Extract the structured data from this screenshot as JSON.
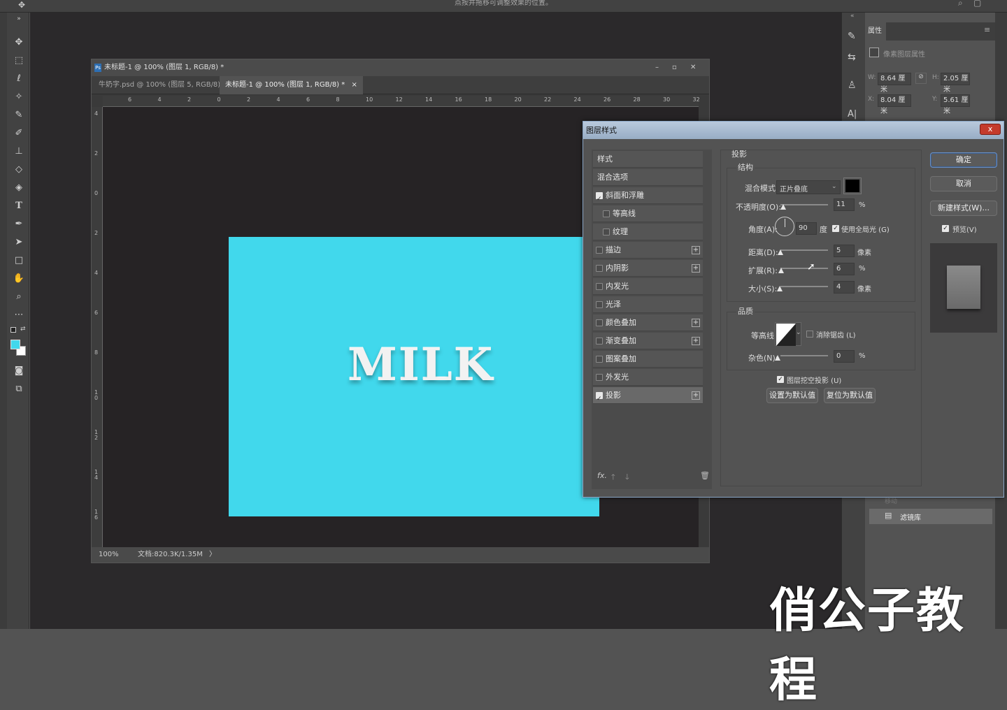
{
  "app": {
    "top_hint": "点按并拖移可调整效果的位置。"
  },
  "document": {
    "title": "未标题-1 @ 100% (图层 1, RGB/8) *",
    "tabs": [
      {
        "label": "牛奶字.psd @ 100% (图层 5, RGB/8) *"
      },
      {
        "label": "未标题-1 @ 100% (图层 1, RGB/8) *"
      }
    ],
    "canvas_text": "MILK",
    "canvas_color": "#41d8ec",
    "status_zoom": "100%",
    "status_doc": "文档:820.3K/1.35M",
    "h_ruler": [
      "6",
      "4",
      "2",
      "0",
      "2",
      "4",
      "6",
      "8",
      "10",
      "12",
      "14",
      "16",
      "18",
      "20",
      "22",
      "24",
      "26",
      "28",
      "30",
      "32"
    ],
    "v_ruler": [
      "4",
      "2",
      "0",
      "2",
      "4",
      "6",
      "8",
      "1 0",
      "1 2",
      "1 4",
      "1 6"
    ]
  },
  "properties_panel": {
    "tab": "属性",
    "subtitle": "像素图层属性",
    "w_label": "W:",
    "w_value": "8.64 厘米",
    "h_label": "H:",
    "h_value": "2.05 厘米",
    "x_label": "X:",
    "x_value": "8.04 厘米",
    "y_label": "Y:",
    "y_value": "5.61 厘米",
    "layer_hidden_label": "移动",
    "layer_filter": "滤镜库"
  },
  "dialog": {
    "title": "图层样式",
    "close": "x",
    "styles": [
      {
        "label": "样式",
        "checkbox": false,
        "checked": false,
        "plus": false,
        "indent": false
      },
      {
        "label": "混合选项",
        "checkbox": false,
        "checked": false,
        "plus": false,
        "indent": false
      },
      {
        "label": "斜面和浮雕",
        "checkbox": true,
        "checked": true,
        "plus": false,
        "indent": false
      },
      {
        "label": "等高线",
        "checkbox": true,
        "checked": false,
        "plus": false,
        "indent": true
      },
      {
        "label": "纹理",
        "checkbox": true,
        "checked": false,
        "plus": false,
        "indent": true
      },
      {
        "label": "描边",
        "checkbox": true,
        "checked": false,
        "plus": true,
        "indent": false
      },
      {
        "label": "内阴影",
        "checkbox": true,
        "checked": false,
        "plus": true,
        "indent": false
      },
      {
        "label": "内发光",
        "checkbox": true,
        "checked": false,
        "plus": false,
        "indent": false
      },
      {
        "label": "光泽",
        "checkbox": true,
        "checked": false,
        "plus": false,
        "indent": false
      },
      {
        "label": "颜色叠加",
        "checkbox": true,
        "checked": false,
        "plus": true,
        "indent": false
      },
      {
        "label": "渐变叠加",
        "checkbox": true,
        "checked": false,
        "plus": true,
        "indent": false
      },
      {
        "label": "图案叠加",
        "checkbox": true,
        "checked": false,
        "plus": false,
        "indent": false
      },
      {
        "label": "外发光",
        "checkbox": true,
        "checked": false,
        "plus": false,
        "indent": false
      },
      {
        "label": "投影",
        "checkbox": true,
        "checked": true,
        "plus": true,
        "indent": false
      }
    ],
    "section_title": "投影",
    "structure_title": "结构",
    "blend_mode_label": "混合模式:",
    "blend_mode_value": "正片叠底",
    "shadow_color": "#000000",
    "opacity_label": "不透明度(O):",
    "opacity_value": "11",
    "opacity_unit": "%",
    "angle_label": "角度(A):",
    "angle_value": "90",
    "angle_unit": "度",
    "global_light_label": "使用全局光 (G)",
    "distance_label": "距离(D):",
    "distance_value": "5",
    "distance_unit": "像素",
    "spread_label": "扩展(R):",
    "spread_value": "6",
    "spread_unit": "%",
    "size_label": "大小(S):",
    "size_value": "4",
    "size_unit": "像素",
    "quality_title": "品质",
    "contour_label": "等高线:",
    "antialias_label": "消除锯齿 (L)",
    "noise_label": "杂色(N):",
    "noise_value": "0",
    "noise_unit": "%",
    "knockout_label": "图层挖空投影 (U)",
    "set_default": "设置为默认值",
    "reset_default": "复位为默认值",
    "ok": "确定",
    "cancel": "取消",
    "new_style": "新建样式(W)...",
    "preview_label": "预览(V)",
    "fx": "fx."
  },
  "watermark": "俏公子教程"
}
